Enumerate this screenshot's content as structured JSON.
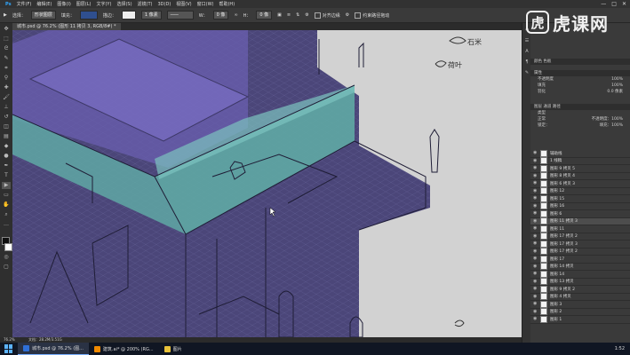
{
  "menu": [
    "文件(F)",
    "编辑(E)",
    "图像(I)",
    "图层(L)",
    "文字(Y)",
    "选择(S)",
    "滤镜(T)",
    "3D(D)",
    "视图(V)",
    "窗口(W)",
    "帮助(H)"
  ],
  "window_controls": [
    "—",
    "□",
    "✕"
  ],
  "options_bar": {
    "tool_mode": "选择：",
    "mode_value": "形状图层",
    "fill_label": "填充：",
    "stroke_label": "描边：",
    "stroke_width": "1 像素",
    "w_label": "W：",
    "w_value": "0 像",
    "h_label": "H：",
    "h_value": "0 像",
    "align_edges": "对齐边缘",
    "auto_select": "约束路径拖动"
  },
  "document_tab": "城市.psd @ 76.2% (图形 11 拷贝 3, RGB/8#) *",
  "status_bar": {
    "zoom": "76.2%",
    "doc": "文档：28.2M/3.51G"
  },
  "brand": {
    "logo_glyph": "虎",
    "text": "虎课网"
  },
  "canvas_notes": {
    "note1": "石米",
    "note2": "荷叶"
  },
  "panels": {
    "tabs": "颜色   色板",
    "properties_title": "属性",
    "rows": [
      {
        "label": "不透明度",
        "value": "100%"
      },
      {
        "label": "填充",
        "value": "100%"
      },
      {
        "label": "羽化",
        "value": "0.0 像素"
      }
    ],
    "layers_tabs": "图层   通道   路径",
    "kind": "类型",
    "blend_mode": "正常",
    "opacity": "不透明度：100%",
    "lock": "锁定：",
    "fill": "填充：100%"
  },
  "layers": [
    {
      "name": "辅助线",
      "selected": false
    },
    {
      "name": "1 线稿",
      "selected": false
    },
    {
      "name": "图形 9 拷贝 5",
      "selected": false
    },
    {
      "name": "图形 8 拷贝 4",
      "selected": false
    },
    {
      "name": "图形 6 拷贝 3",
      "selected": false
    },
    {
      "name": "图形 12",
      "selected": false
    },
    {
      "name": "图形 15",
      "selected": false
    },
    {
      "name": "图形 16",
      "selected": false
    },
    {
      "name": "图形 6",
      "selected": false
    },
    {
      "name": "图形 11 拷贝 3",
      "selected": true
    },
    {
      "name": "图形 11",
      "selected": false
    },
    {
      "name": "图形 17 拷贝 2",
      "selected": false
    },
    {
      "name": "图形 17 拷贝 3",
      "selected": false
    },
    {
      "name": "图形 17 拷贝 2",
      "selected": false
    },
    {
      "name": "图形 17",
      "selected": false
    },
    {
      "name": "图形 14 拷贝",
      "selected": false
    },
    {
      "name": "图形 14",
      "selected": false
    },
    {
      "name": "图形 13 拷贝",
      "selected": false
    },
    {
      "name": "图形 9 拷贝 2",
      "selected": false
    },
    {
      "name": "图形 4 拷贝",
      "selected": false
    },
    {
      "name": "图形 3",
      "selected": false
    },
    {
      "name": "图形 2",
      "selected": false
    },
    {
      "name": "图形 1",
      "selected": false
    }
  ],
  "taskbar": [
    {
      "label": "城市.psd @ 76.2% (图...",
      "color": "#2f6fd6",
      "active": true
    },
    {
      "label": "建筑.ai* @ 200% (RG...",
      "color": "#f08a00",
      "active": false
    },
    {
      "label": "图片",
      "color": "#e8c23a",
      "active": false
    }
  ],
  "clock": "1:52",
  "colors": {
    "wall_purple": "#4b4679",
    "glass_teal": "#5fa8a4",
    "canvas_bg": "#d2d2d2",
    "accent_blue": "#2f6fd6"
  }
}
